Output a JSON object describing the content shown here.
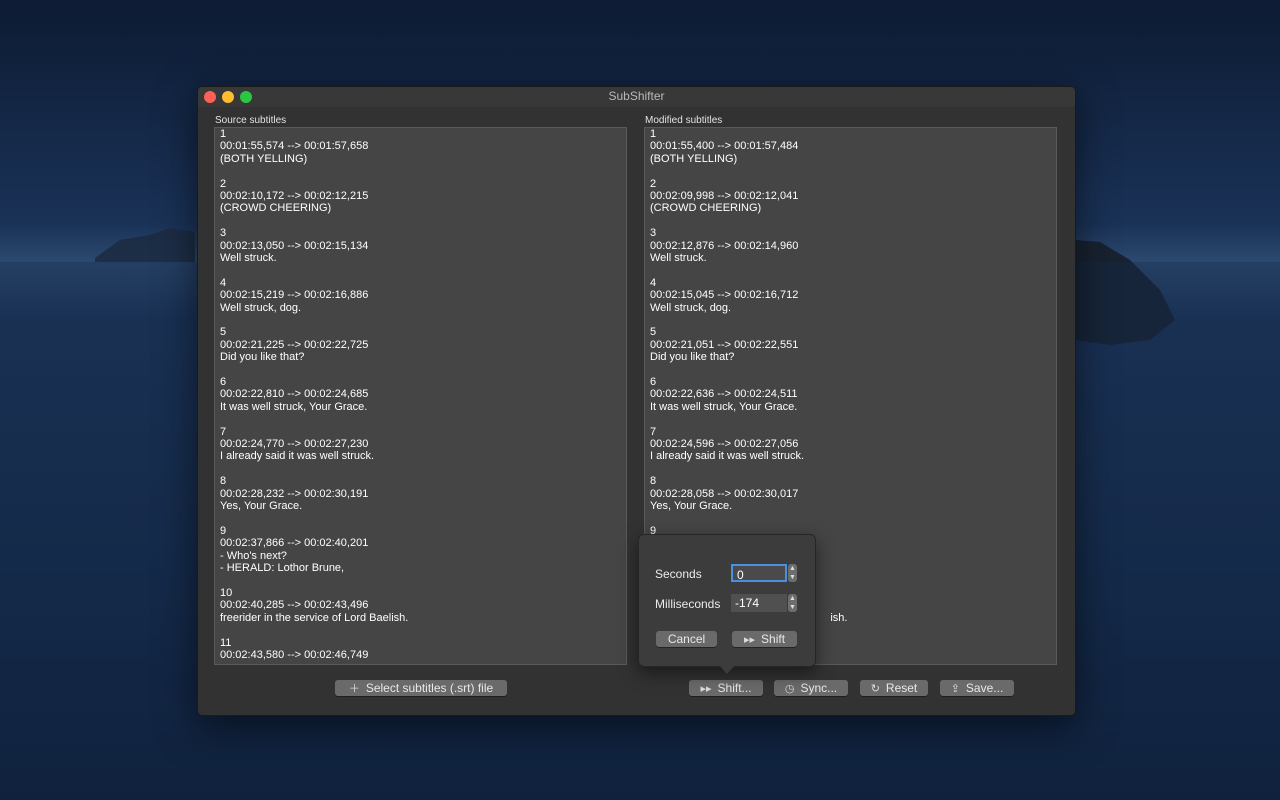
{
  "window": {
    "title": "SubShifter"
  },
  "source": {
    "label": "Source subtitles",
    "lines": [
      "1",
      "00:01:55,574 --> 00:01:57,658",
      "(BOTH YELLING)",
      "",
      "2",
      "00:02:10,172 --> 00:02:12,215",
      "(CROWD CHEERING)",
      "",
      "3",
      "00:02:13,050 --> 00:02:15,134",
      "Well struck.",
      "",
      "4",
      "00:02:15,219 --> 00:02:16,886",
      "Well struck, dog.",
      "",
      "5",
      "00:02:21,225 --> 00:02:22,725",
      "Did you like that?",
      "",
      "6",
      "00:02:22,810 --> 00:02:24,685",
      "It was well struck, Your Grace.",
      "",
      "7",
      "00:02:24,770 --> 00:02:27,230",
      "I already said it was well struck.",
      "",
      "8",
      "00:02:28,232 --> 00:02:30,191",
      "Yes, Your Grace.",
      "",
      "9",
      "00:02:37,866 --> 00:02:40,201",
      "- Who's next?",
      "- HERALD: Lothor Brune,",
      "",
      "10",
      "00:02:40,285 --> 00:02:43,496",
      "freerider in the service of Lord Baelish.",
      "",
      "11",
      "00:02:43,580 --> 00:02:46,749"
    ]
  },
  "modified": {
    "label": "Modified subtitles",
    "lines": [
      "1",
      "00:01:55,400 --> 00:01:57,484",
      "(BOTH YELLING)",
      "",
      "2",
      "00:02:09,998 --> 00:02:12,041",
      "(CROWD CHEERING)",
      "",
      "3",
      "00:02:12,876 --> 00:02:14,960",
      "Well struck.",
      "",
      "4",
      "00:02:15,045 --> 00:02:16,712",
      "Well struck, dog.",
      "",
      "5",
      "00:02:21,051 --> 00:02:22,551",
      "Did you like that?",
      "",
      "6",
      "00:02:22,636 --> 00:02:24,511",
      "It was well struck, Your Grace.",
      "",
      "7",
      "00:02:24,596 --> 00:02:27,056",
      "I already said it was well struck.",
      "",
      "8",
      "00:02:28,058 --> 00:02:30,017",
      "Yes, Your Grace.",
      "",
      "9",
      "",
      "",
      "",
      "",
      "",
      "",
      "                                                           ish.",
      "",
      ""
    ]
  },
  "toolbar": {
    "select_label": "Select subtitles (.srt) file",
    "shift_label": "Shift...",
    "sync_label": "Sync...",
    "reset_label": "Reset",
    "save_label": "Save..."
  },
  "shift_popover": {
    "seconds_label": "Seconds",
    "seconds_value": "0",
    "milliseconds_label": "Milliseconds",
    "milliseconds_value": "-174",
    "cancel_label": "Cancel",
    "shift_label": "Shift"
  }
}
